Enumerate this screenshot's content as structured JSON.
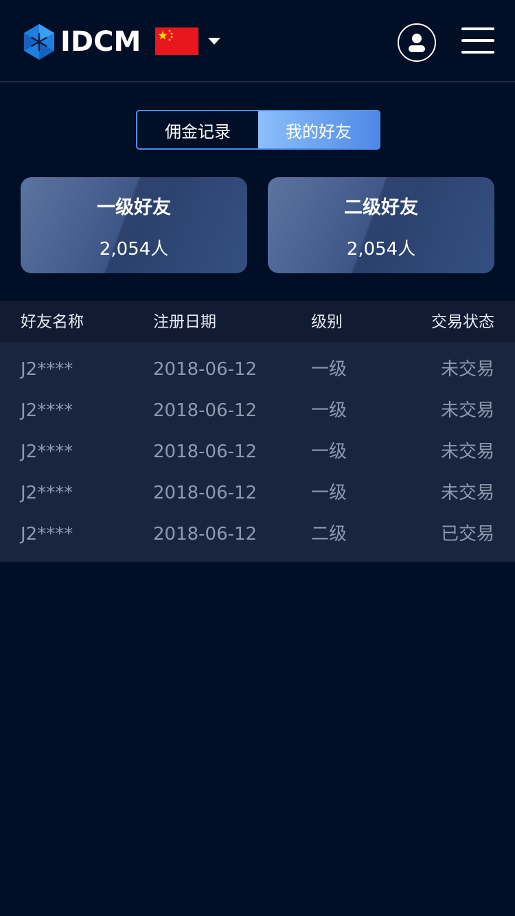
{
  "header": {
    "logo_text": "IDCM",
    "language_flag": "china-flag",
    "colors": {
      "background": "#000e26",
      "accent": "#4f8fea"
    }
  },
  "tabs": [
    {
      "label": "佣金记录",
      "active": false
    },
    {
      "label": "我的好友",
      "active": true
    }
  ],
  "cards": [
    {
      "title": "一级好友",
      "value": "2,054人"
    },
    {
      "title": "二级好友",
      "value": "2,054人"
    }
  ],
  "table": {
    "headers": [
      "好友名称",
      "注册日期",
      "级别",
      "交易状态"
    ],
    "rows": [
      [
        "J2****",
        "2018-06-12",
        "一级",
        "未交易"
      ],
      [
        "J2****",
        "2018-06-12",
        "一级",
        "未交易"
      ],
      [
        "J2****",
        "2018-06-12",
        "一级",
        "未交易"
      ],
      [
        "J2****",
        "2018-06-12",
        "一级",
        "未交易"
      ],
      [
        "J2****",
        "2018-06-12",
        "二级",
        "已交易"
      ]
    ]
  }
}
